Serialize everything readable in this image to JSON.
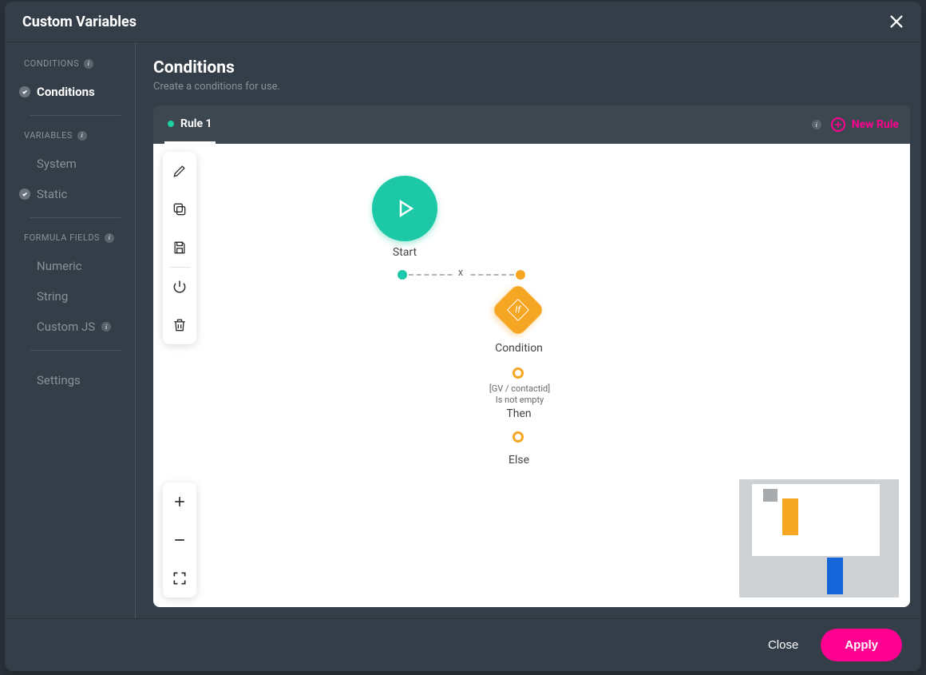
{
  "modal": {
    "title": "Custom Variables"
  },
  "sidebar": {
    "sections": [
      {
        "header": "CONDITIONS",
        "items": [
          {
            "label": "Conditions",
            "checked": true,
            "active": true
          }
        ]
      },
      {
        "header": "VARIABLES",
        "items": [
          {
            "label": "System",
            "checked": false,
            "active": false
          },
          {
            "label": "Static",
            "checked": true,
            "active": false
          }
        ]
      },
      {
        "header": "FORMULA FIELDS",
        "items": [
          {
            "label": "Numeric",
            "checked": false,
            "active": false
          },
          {
            "label": "String",
            "checked": false,
            "active": false
          },
          {
            "label": "Custom JS",
            "checked": false,
            "active": false,
            "badge": true
          }
        ]
      }
    ],
    "settings_label": "Settings"
  },
  "main": {
    "title": "Conditions",
    "subtitle": "Create a conditions for use.",
    "active_tab": "Rule 1",
    "new_rule_label": "New Rule"
  },
  "flow": {
    "start_label": "Start",
    "condition_label": "Condition",
    "condition_expr_line1": "[GV / contactid]",
    "condition_expr_line2": "Is not empty",
    "then_label": "Then",
    "else_label": "Else",
    "connector_remove": "x"
  },
  "footer": {
    "close": "Close",
    "apply": "Apply"
  }
}
